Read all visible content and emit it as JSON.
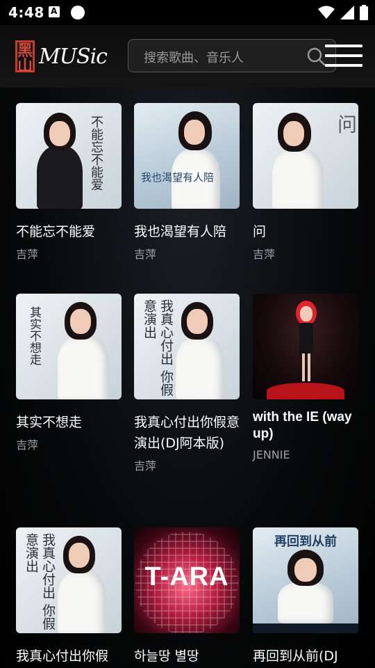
{
  "status_bar": {
    "time": "4:48"
  },
  "header": {
    "logo_seal": "黑山",
    "logo_text": "MUSic",
    "search_placeholder": "搜索歌曲、音乐人"
  },
  "songs": [
    {
      "title": "不能忘不能爱",
      "artist": "吉萍",
      "cover_text": "不能忘不能爱"
    },
    {
      "title": "我也渴望有人陪",
      "artist": "吉萍",
      "cover_text": "我也渴望有人陪"
    },
    {
      "title": "问",
      "artist": "吉萍",
      "cover_text": "问"
    },
    {
      "title": "其实不想走",
      "artist": "吉萍",
      "cover_text": "其实不想走"
    },
    {
      "title": "我真心付出你假意演出(DJ阿本版)",
      "artist": "吉萍",
      "cover_text": "我真心付出 你假意演出"
    },
    {
      "title": "with the IE (way up)",
      "artist": "JENNIE",
      "cover_text": ""
    },
    {
      "title": "我真心付出你假",
      "artist": "",
      "cover_text": "我真心付出 你假意演出"
    },
    {
      "title": "하늘땅 별땅",
      "artist": "",
      "cover_text": "T-ARA"
    },
    {
      "title": "再回到从前(DJ",
      "artist": "",
      "cover_text": "再回到从前"
    }
  ],
  "colors": {
    "accent_red": "#c93a2b",
    "background": "#000000",
    "muted_text": "#9ea3a8"
  }
}
